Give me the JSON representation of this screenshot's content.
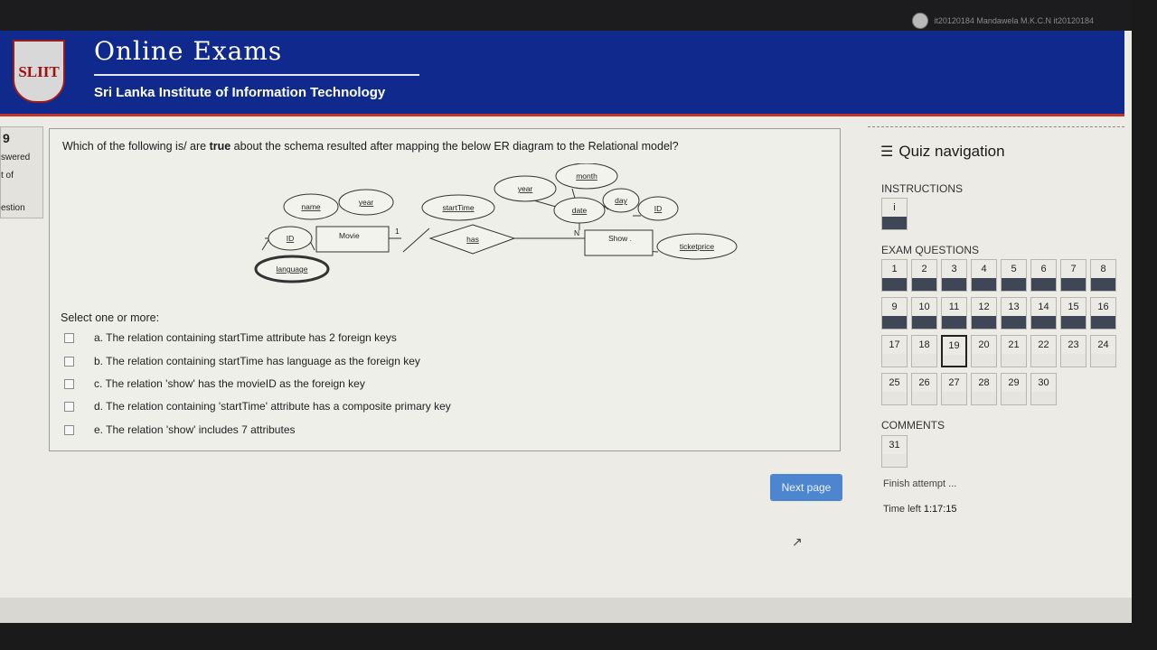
{
  "user": {
    "name": "it20120184 Mandawela M.K.C.N it20120184"
  },
  "header": {
    "logo_text": "SLIIT",
    "title": "Online Exams",
    "subtitle": "Sri Lanka Institute of Information Technology"
  },
  "question_info": {
    "number": "9",
    "status": "swered",
    "mark": "t of",
    "flag": "estion"
  },
  "question": {
    "text_before": "Which of the following is/ are ",
    "text_bold": "true",
    "text_after": " about the schema resulted after mapping the below ER diagram to the Relational model?",
    "select_label": "Select one or more:",
    "options": [
      "a. The relation containing startTime attribute has 2 foreign keys",
      "b. The relation containing startTime has language as the foreign key",
      "c. The relation 'show' has the movieID as the foreign key",
      "d. The relation containing 'startTime' attribute has a composite primary key",
      "e. The relation 'show' includes 7 attributes"
    ]
  },
  "er_diagram": {
    "movie": "Movie",
    "show": "Show .",
    "has": "has",
    "movie_attrs": {
      "name": "name",
      "year": "year",
      "id": "ID",
      "language": "language"
    },
    "rel_attr": "startTime",
    "show_attrs": {
      "year": "year",
      "month": "month",
      "date": "date",
      "day": "day",
      "id": "ID",
      "ticketprice": "ticketprice"
    },
    "card_one": "1",
    "card_n": "N"
  },
  "next_button": "Next page",
  "nav": {
    "title": "Quiz navigation",
    "instructions_label": "INSTRUCTIONS",
    "instructions_items": [
      "i"
    ],
    "exam_label": "EXAM QUESTIONS",
    "rows": [
      [
        "1",
        "2",
        "3",
        "4",
        "5",
        "6",
        "7",
        "8"
      ],
      [
        "9",
        "10",
        "11",
        "12",
        "13",
        "14",
        "15",
        "16"
      ],
      [
        "17",
        "18",
        "19",
        "20",
        "21",
        "22",
        "23",
        "24"
      ],
      [
        "25",
        "26",
        "27",
        "28",
        "29",
        "30"
      ]
    ],
    "comments_label": "COMMENTS",
    "comments_items": [
      "31"
    ],
    "answered": [
      "1",
      "2",
      "3",
      "4",
      "5",
      "6",
      "7",
      "8",
      "9",
      "10",
      "11",
      "12",
      "13",
      "14",
      "15",
      "16",
      "i"
    ],
    "current": "19"
  },
  "finish": "Finish attempt ...",
  "time_label": "Time left",
  "time_value": "1:17:15",
  "colors": {
    "banner": "#0f2a8c",
    "button": "#4d86cf",
    "answered": "#3f4656"
  }
}
